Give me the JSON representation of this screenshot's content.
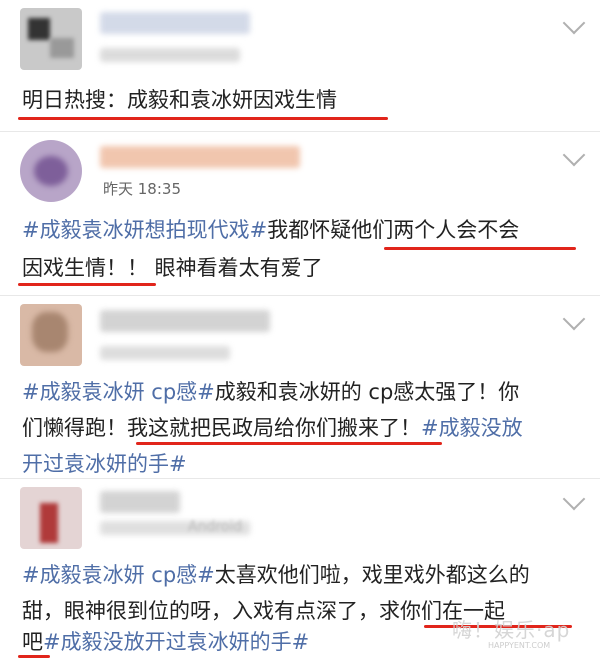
{
  "posts": [
    {
      "timestamp_blurred": "昨天 19:38 来自",
      "segments": [
        {
          "text": "明日热搜：成毅和袁冰妍因戏生情",
          "tag": false
        }
      ]
    },
    {
      "timestamp": "昨天 18:35",
      "line1": [
        {
          "text": "#成毅袁冰妍想拍现代戏#",
          "tag": true
        },
        {
          "text": "我都怀疑他们两个人会不会",
          "tag": false
        }
      ],
      "line2": [
        {
          "text": "因戏生情！！ 眼神看着太有爱了",
          "tag": false
        }
      ]
    },
    {
      "line1": [
        {
          "text": "#成毅袁冰妍 cp感#",
          "tag": true
        },
        {
          "text": "成毅和袁冰妍的 cp感太强了！你",
          "tag": false
        }
      ],
      "line2": [
        {
          "text": "们懒得跑！我这就把民政局给你们搬来了！",
          "tag": false
        },
        {
          "text": "#成毅没放",
          "tag": true
        }
      ],
      "line3": [
        {
          "text": "开过袁冰妍的手#",
          "tag": true
        }
      ]
    },
    {
      "meta_blurred": "Android",
      "line1": [
        {
          "text": "#成毅袁冰妍 cp感#",
          "tag": true
        },
        {
          "text": "太喜欢他们啦，戏里戏外都这么的",
          "tag": false
        }
      ],
      "line2": [
        {
          "text": "甜，眼神很到位的呀，入戏有点深了，求你们在一起",
          "tag": false
        }
      ],
      "line3": [
        {
          "text": "吧",
          "tag": false
        },
        {
          "text": "#成毅没放开过袁冰妍的手#",
          "tag": true
        }
      ]
    }
  ],
  "watermark": {
    "text": "嗨！娱乐·ap",
    "sub": "HAPPYENT.COM"
  },
  "colors": {
    "topic": "#4f6ea7",
    "underline": "#e1251b",
    "text": "#222222"
  }
}
